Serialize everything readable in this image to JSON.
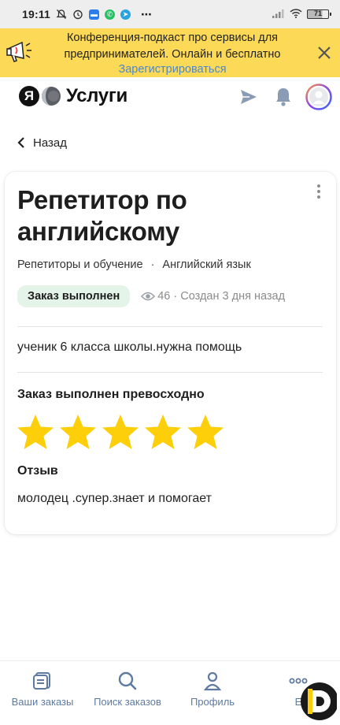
{
  "status_bar": {
    "time": "19:11",
    "battery": "71",
    "more": "⋯"
  },
  "promo": {
    "text": "Конференция-подкаст про сервисы для предпринимателей. Онлайн и бесплатно",
    "link": "Зарегистрироваться"
  },
  "header": {
    "logo_letter": "Я",
    "logo_text": "Услуги"
  },
  "nav": {
    "back_label": "Назад"
  },
  "order": {
    "title": "Репетитор по английскому",
    "category": "Репетиторы и обучение",
    "separator": "·",
    "subcategory": "Английский язык",
    "status_badge": "Заказ выполнен",
    "meta": "46 · Создан 3 дня назад",
    "description": "ученик 6 класса школы.нужна помощь",
    "rating_title": "Заказ выполнен превосходно",
    "rating": 5,
    "rating_max": 5,
    "review_title": "Отзыв",
    "review_text": "молодец .супер.знает и помогает"
  },
  "bottom_nav": {
    "items": [
      {
        "label": "Ваши заказы",
        "icon": "orders-icon"
      },
      {
        "label": "Поиск заказов",
        "icon": "search-icon"
      },
      {
        "label": "Профиль",
        "icon": "profile-icon"
      },
      {
        "label": "Е",
        "icon": "more-icon"
      }
    ]
  },
  "colors": {
    "promo_bg": "#fdd958",
    "link": "#4d88c6",
    "badge_bg": "#e5f4e8",
    "star": "#fdcf0b",
    "nav_text": "#5e7aa0"
  }
}
